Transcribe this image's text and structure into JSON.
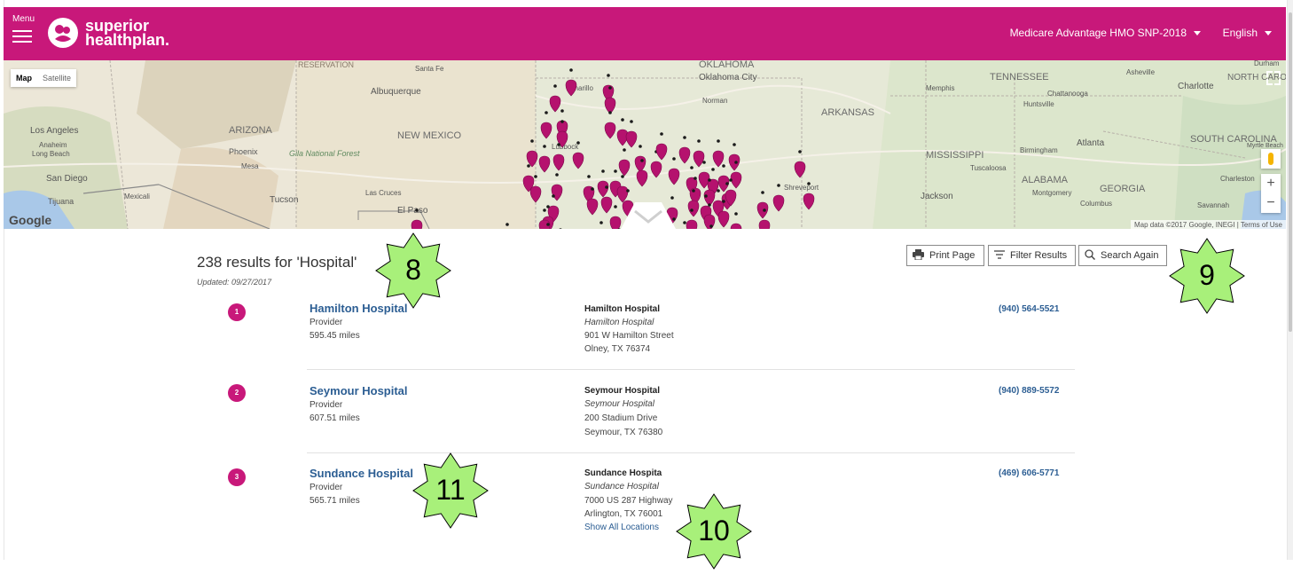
{
  "header": {
    "menu_label": "Menu",
    "logo_line1": "superior",
    "logo_line2": "healthplan.",
    "plan": "Medicare Advantage HMO SNP-2018",
    "language": "English",
    "background_color": "#c8187a"
  },
  "map": {
    "type_map": "Map",
    "type_satellite": "Satellite",
    "google": "Google",
    "attribution": "Map data ©2017 Google, INEGI  |  Terms of Use",
    "zoom_in": "+",
    "zoom_out": "−",
    "marker_color": "#b5126e",
    "labels": {
      "reservation": "RESERVATION",
      "santa_fe": "Santa Fe",
      "albuquerque": "Albuquerque",
      "oklahoma": "OKLAHOMA",
      "oklahoma_city": "Oklahoma City",
      "norman": "Norman",
      "amarillo": "Amarillo",
      "memphis": "Memphis",
      "tennessee": "TENNESSEE",
      "chattanooga": "Chattanooga",
      "asheville": "Asheville",
      "charlotte": "Charlotte",
      "north_carolina": "NORTH CAROLINA",
      "durham": "Durham",
      "huntsville": "Huntsville",
      "arkansas": "ARKANSAS",
      "los_angeles": "Los Angeles",
      "anaheim": "Anaheim",
      "long_beach": "Long Beach",
      "arizona": "ARIZONA",
      "phoenix": "Phoenix",
      "mesa": "Mesa",
      "gila": "Gila National Forest",
      "new_mexico": "NEW MEXICO",
      "lubbock": "Lubbock",
      "atlanta": "Atlanta",
      "birmingham": "Birmingham",
      "mississippi": "MISSISSIPPI",
      "tuscaloosa": "Tuscaloosa",
      "south_carolina": "SOUTH CAROLINA",
      "myrtle_beach": "Myrtle Beach",
      "san_diego": "San Diego",
      "tijuana": "Tijuana",
      "mexicali": "Mexicali",
      "tucson": "Tucson",
      "las_cruces": "Las Cruces",
      "el_paso": "El Paso",
      "shreveport": "Shreveport",
      "alabama": "ALABAMA",
      "montgomery": "Montgomery",
      "jackson": "Jackson",
      "georgia": "GEORGIA",
      "columbus": "Columbus",
      "charleston": "Charleston",
      "savannah": "Savannah"
    }
  },
  "results": {
    "title": "238 results for 'Hospital'",
    "updated": "Updated: 09/27/2017",
    "print_label": "Print Page",
    "filter_label": "Filter Results",
    "search_again_label": "Search Again",
    "show_all_locations": "Show All Locations",
    "items": [
      {
        "num": "1",
        "name": "Hamilton Hospital",
        "type": "Provider",
        "distance": "595.45 miles",
        "addr_name": "Hamilton Hospital",
        "addr_alt": "Hamilton Hospital",
        "street": "901 W Hamilton Street",
        "city": "Olney, TX 76374",
        "phone": "(940) 564-5521"
      },
      {
        "num": "2",
        "name": "Seymour Hospital",
        "type": "Provider",
        "distance": "607.51 miles",
        "addr_name": "Seymour Hospital",
        "addr_alt": "Seymour Hospital",
        "street": "200 Stadium Drive",
        "city": "Seymour, TX 76380",
        "phone": "(940) 889-5572"
      },
      {
        "num": "3",
        "name": "Sundance Hospital",
        "type": "Provider",
        "distance": "565.71 miles",
        "addr_name": "Sundance Hospita",
        "addr_alt": "Sundance Hospital",
        "street": "7000 US 287 Highway",
        "city": "Arlington, TX 76001",
        "phone": "(469) 606-5771"
      }
    ]
  },
  "callouts": {
    "c8": "8",
    "c9": "9",
    "c10": "10",
    "c11": "11",
    "fill": "#a8f07a"
  }
}
